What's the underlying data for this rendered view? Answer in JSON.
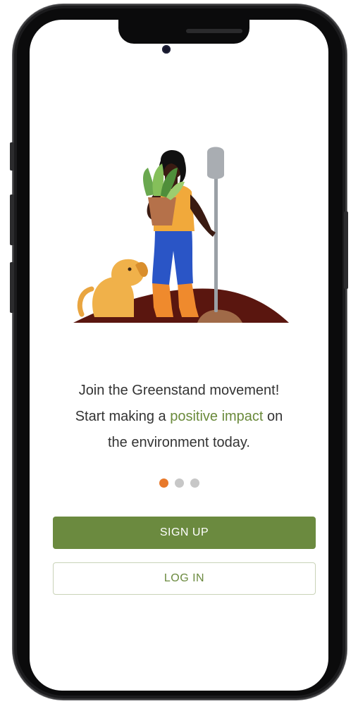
{
  "onboarding": {
    "headline_line1": "Join the Greenstand movement!",
    "headline_pre": "Start making a ",
    "headline_accent": "positive impact",
    "headline_post": " on",
    "headline_line3": "the environment today.",
    "pager": {
      "total": 3,
      "active_index": 0
    }
  },
  "actions": {
    "signup_label": "SIGN UP",
    "login_label": "LOG IN"
  },
  "colors": {
    "brand_green": "#6b8a3f",
    "accent_orange": "#e8792b",
    "inactive_dot": "#c7c7c7",
    "headline_text": "#333333"
  },
  "illustration": {
    "icon": "gardener-with-dog-illustration"
  }
}
